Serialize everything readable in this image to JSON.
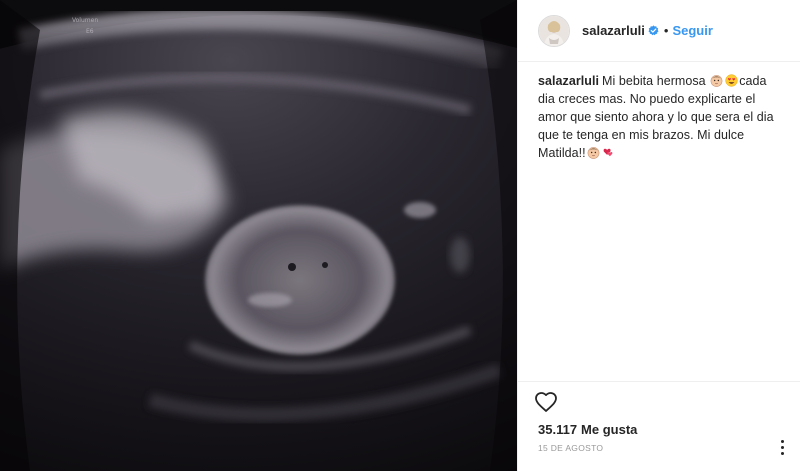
{
  "post": {
    "username": "salazarluli",
    "verified": true,
    "follow_label": "Seguir",
    "separator": "•",
    "caption": {
      "segments": [
        {
          "type": "text",
          "value": "Mi bebita hermosa "
        },
        {
          "type": "emoji",
          "icon": "baby-face-emoji"
        },
        {
          "type": "emoji",
          "icon": "heart-eyes-emoji"
        },
        {
          "type": "text",
          "value": "cada dia creces mas. No puedo explicarte el amor que siento ahora y lo que sera el dia que te tenga en mis brazos. Mi dulce Matilda!!"
        },
        {
          "type": "emoji",
          "icon": "baby-face-emoji"
        },
        {
          "type": "emoji",
          "icon": "revolving-hearts-emoji"
        }
      ]
    },
    "likes_count": "35.117",
    "likes_label": "Me gusta",
    "date": "15 DE AGOSTO",
    "image": {
      "description_icon": "ultrasound-image",
      "overlay_text_1": "Volumen",
      "overlay_text_2": "E6"
    }
  },
  "colors": {
    "follow": "#3897f0",
    "text": "#262626",
    "muted": "#999999",
    "border": "#efefef",
    "verified": "#3897f0"
  }
}
